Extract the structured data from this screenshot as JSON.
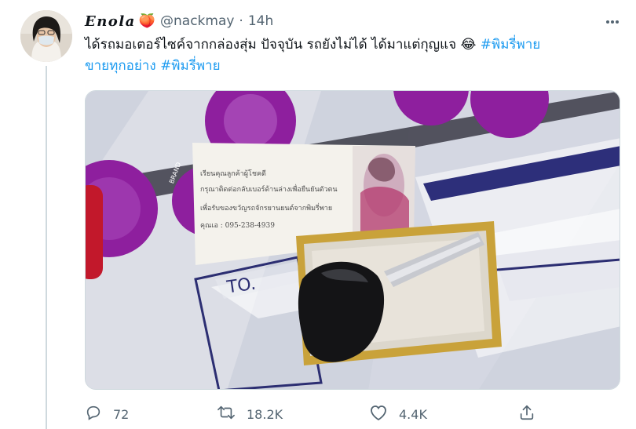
{
  "tweet": {
    "display_name": "Enola",
    "emoji": "🍑",
    "handle": "@nackmay",
    "separator": "·",
    "time": "14h",
    "text_line1": "ได้รถมอเตอร์ไซค์จากกล่องสุ่ม ปัจจุบัน รถยังไม่ได้ ได้มาแต่กุญแจ 😂",
    "hashtag1": "#พิมรี่พาย",
    "text_line2": "ขายทุกอย่าง",
    "hashtag2": "#พิมรี่พาย",
    "icons": {
      "more": "more-horizontal-icon",
      "reply": "reply-icon",
      "retweet": "retweet-icon",
      "like": "heart-icon",
      "share": "share-icon"
    }
  },
  "media": {
    "card_lines": [
      "เรียนคุณลูกค้าผู้โชคดี",
      "กรุณาติดต่อกลับเบอร์ด้านล่างเพื่อยืนยันตัวตน",
      "เพื่อรับของขวัญรถจักรยานยนต์จากพิมรี่พาย",
      "คุณเอ   :  095-238-4939"
    ],
    "box_label": "TO.",
    "brand_text": "BRAND"
  },
  "actions": {
    "replies": "72",
    "retweets": "18.2K",
    "likes": "4.4K"
  },
  "colors": {
    "accent": "#1d9bf0",
    "secondary_text": "#536471",
    "purple_print": "#8e1f9e"
  }
}
